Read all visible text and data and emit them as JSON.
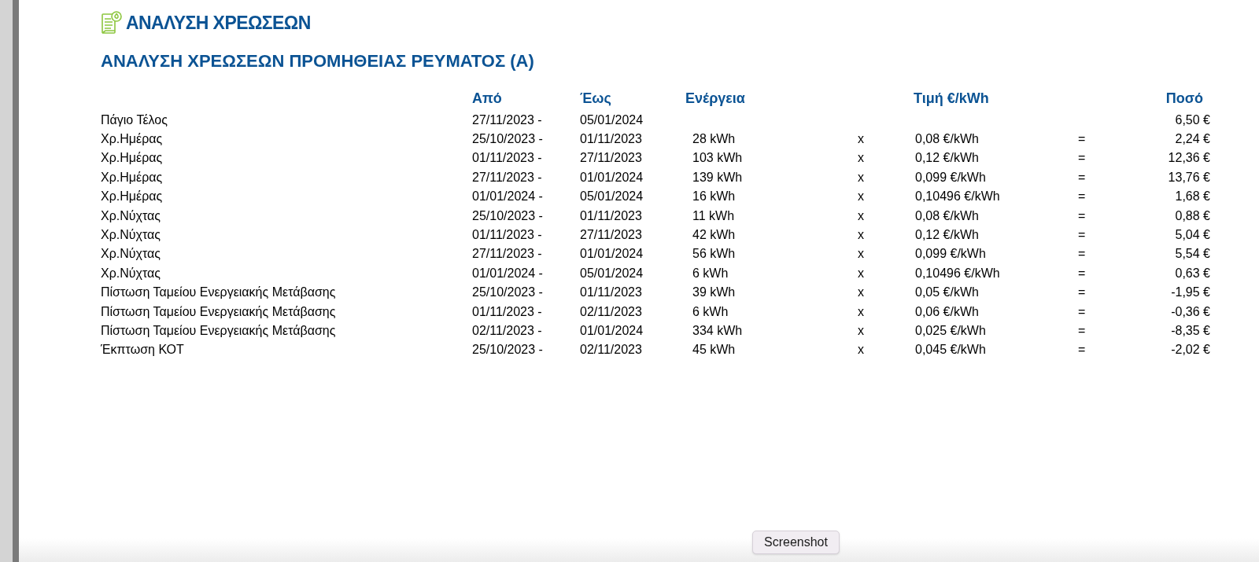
{
  "page_heading": "ΑΝΑΛΥΣΗ ΧΡΕΩΣΕΩΝ",
  "section_title": "ΑΝΑΛΥΣΗ ΧΡΕΩΣΕΩΝ ΠΡΟΜΗΘΕΙΑΣ ΡΕΥΜΑΤΟΣ (Α)",
  "table": {
    "columns": {
      "from": "Από",
      "to": "Έως",
      "energy": "Ενέργεια",
      "price": "Τιμή €/kWh",
      "amount": "Ποσό"
    },
    "rows": [
      {
        "description": "Πάγιο Τέλος",
        "from": "27/11/2023 -",
        "to": "05/01/2024",
        "amount": "6,50 €"
      },
      {
        "description": "Χρ.Ημέρας",
        "from": "25/10/2023 -",
        "to": "01/11/2023",
        "energy": "28 kWh",
        "times": "x",
        "price": "0,08 €/kWh",
        "equals": "=",
        "amount": "2,24 €"
      },
      {
        "description": "Χρ.Ημέρας",
        "from": "01/11/2023 -",
        "to": "27/11/2023",
        "energy": "103 kWh",
        "times": "x",
        "price": "0,12 €/kWh",
        "equals": "=",
        "amount": "12,36 €"
      },
      {
        "description": "Χρ.Ημέρας",
        "from": "27/11/2023 -",
        "to": "01/01/2024",
        "energy": "139 kWh",
        "times": "x",
        "price": "0,099 €/kWh",
        "equals": "=",
        "amount": "13,76 €"
      },
      {
        "description": "Χρ.Ημέρας",
        "from": "01/01/2024 -",
        "to": "05/01/2024",
        "energy": "16 kWh",
        "times": "x",
        "price": "0,10496 €/kWh",
        "equals": "=",
        "amount": "1,68 €"
      },
      {
        "description": "Χρ.Νύχτας",
        "from": "25/10/2023 -",
        "to": "01/11/2023",
        "energy": "11 kWh",
        "times": "x",
        "price": "0,08 €/kWh",
        "equals": "=",
        "amount": "0,88 €"
      },
      {
        "description": "Χρ.Νύχτας",
        "from": "01/11/2023 -",
        "to": "27/11/2023",
        "energy": "42 kWh",
        "times": "x",
        "price": "0,12 €/kWh",
        "equals": "=",
        "amount": "5,04 €"
      },
      {
        "description": "Χρ.Νύχτας",
        "from": "27/11/2023 -",
        "to": "01/01/2024",
        "energy": "56 kWh",
        "times": "x",
        "price": "0,099 €/kWh",
        "equals": "=",
        "amount": "5,54 €"
      },
      {
        "description": "Χρ.Νύχτας",
        "from": "01/01/2024 -",
        "to": "05/01/2024",
        "energy": "6 kWh",
        "times": "x",
        "price": "0,10496 €/kWh",
        "equals": "=",
        "amount": "0,63 €"
      },
      {
        "description": "Πίστωση Ταμείου Ενεργειακής Μετάβασης",
        "from": "25/10/2023 -",
        "to": "01/11/2023",
        "energy": "39 kWh",
        "times": "x",
        "price": "0,05 €/kWh",
        "equals": "=",
        "amount": "-1,95 €"
      },
      {
        "description": "Πίστωση Ταμείου Ενεργειακής Μετάβασης",
        "from": "01/11/2023 -",
        "to": "02/11/2023",
        "energy": "6 kWh",
        "times": "x",
        "price": "0,06 €/kWh",
        "equals": "=",
        "amount": "-0,36 €"
      },
      {
        "description": "Πίστωση Ταμείου Ενεργειακής Μετάβασης",
        "from": "02/11/2023 -",
        "to": "01/01/2024",
        "energy": "334 kWh",
        "times": "x",
        "price": "0,025 €/kWh",
        "equals": "=",
        "amount": "-8,35 €"
      },
      {
        "description": "Έκπτωση ΚΟΤ",
        "from": "25/10/2023 -",
        "to": "02/11/2023",
        "energy": "45 kWh",
        "times": "x",
        "price": "0,045 €/kWh",
        "equals": "=",
        "amount": "-2,02 €"
      }
    ]
  },
  "tooltip": "Screenshot"
}
